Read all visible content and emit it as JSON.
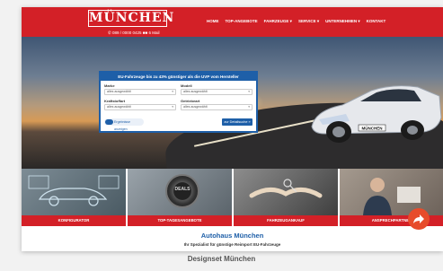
{
  "header": {
    "logo_text": "MÜNCHEN",
    "phone": "✆ 089 / 0000 0425 ■■ 6 Mail",
    "nav": [
      "HOME",
      "TOP-ANGEBOTE",
      "FAHRZEUGE ▾",
      "SERVICE ▾",
      "UNTERNEHMEN ▾",
      "KONTAKT"
    ]
  },
  "search_form": {
    "title": "EU-Fahrzeuge bis zu 43% günstiger als die UVP vom Hersteller",
    "fields": [
      {
        "label": "Marke",
        "value": "alles ausgewählt"
      },
      {
        "label": "Modell",
        "value": "alles ausgewählt"
      },
      {
        "label": "Kraftstoffart",
        "value": "alles ausgewählt"
      },
      {
        "label": "Getriebeart",
        "value": "alles ausgewählt"
      }
    ],
    "toggle_label": "Ergebnisse anzeigen",
    "search_button": "zur Detailsuche »"
  },
  "hero": {
    "plate": "MÜNCHEN"
  },
  "tiles": [
    {
      "caption": "KONFIGURATOR"
    },
    {
      "caption": "TOP-TAGESANGEBOTE"
    },
    {
      "caption": "FAHRZEUGANKAUF"
    },
    {
      "caption": "ANSPRECHPARTNER"
    }
  ],
  "deals_button_text": "DEALS",
  "footer": {
    "title": "Autohaus München",
    "subtitle": "Ihr Spezialist für günstige Reimport EU-Fahrzeuge"
  },
  "caption": "Designset München",
  "colors": {
    "brand_red": "#d32027",
    "brand_blue": "#1e5fa8",
    "fab": "#e74c2b"
  },
  "icons": [
    "share-icon"
  ]
}
